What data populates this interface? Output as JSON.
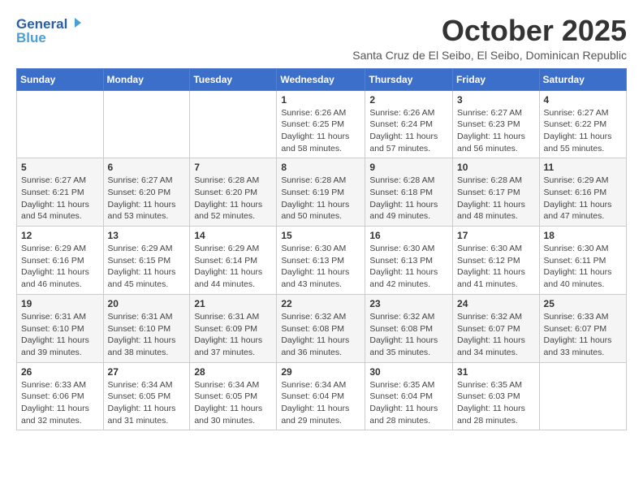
{
  "logo": {
    "line1": "General",
    "line2": "Blue"
  },
  "title": "October 2025",
  "subtitle": "Santa Cruz de El Seibo, El Seibo, Dominican Republic",
  "days_header": [
    "Sunday",
    "Monday",
    "Tuesday",
    "Wednesday",
    "Thursday",
    "Friday",
    "Saturday"
  ],
  "weeks": [
    [
      {
        "day": "",
        "info": ""
      },
      {
        "day": "",
        "info": ""
      },
      {
        "day": "",
        "info": ""
      },
      {
        "day": "1",
        "info": "Sunrise: 6:26 AM\nSunset: 6:25 PM\nDaylight: 11 hours\nand 58 minutes."
      },
      {
        "day": "2",
        "info": "Sunrise: 6:26 AM\nSunset: 6:24 PM\nDaylight: 11 hours\nand 57 minutes."
      },
      {
        "day": "3",
        "info": "Sunrise: 6:27 AM\nSunset: 6:23 PM\nDaylight: 11 hours\nand 56 minutes."
      },
      {
        "day": "4",
        "info": "Sunrise: 6:27 AM\nSunset: 6:22 PM\nDaylight: 11 hours\nand 55 minutes."
      }
    ],
    [
      {
        "day": "5",
        "info": "Sunrise: 6:27 AM\nSunset: 6:21 PM\nDaylight: 11 hours\nand 54 minutes."
      },
      {
        "day": "6",
        "info": "Sunrise: 6:27 AM\nSunset: 6:20 PM\nDaylight: 11 hours\nand 53 minutes."
      },
      {
        "day": "7",
        "info": "Sunrise: 6:28 AM\nSunset: 6:20 PM\nDaylight: 11 hours\nand 52 minutes."
      },
      {
        "day": "8",
        "info": "Sunrise: 6:28 AM\nSunset: 6:19 PM\nDaylight: 11 hours\nand 50 minutes."
      },
      {
        "day": "9",
        "info": "Sunrise: 6:28 AM\nSunset: 6:18 PM\nDaylight: 11 hours\nand 49 minutes."
      },
      {
        "day": "10",
        "info": "Sunrise: 6:28 AM\nSunset: 6:17 PM\nDaylight: 11 hours\nand 48 minutes."
      },
      {
        "day": "11",
        "info": "Sunrise: 6:29 AM\nSunset: 6:16 PM\nDaylight: 11 hours\nand 47 minutes."
      }
    ],
    [
      {
        "day": "12",
        "info": "Sunrise: 6:29 AM\nSunset: 6:16 PM\nDaylight: 11 hours\nand 46 minutes."
      },
      {
        "day": "13",
        "info": "Sunrise: 6:29 AM\nSunset: 6:15 PM\nDaylight: 11 hours\nand 45 minutes."
      },
      {
        "day": "14",
        "info": "Sunrise: 6:29 AM\nSunset: 6:14 PM\nDaylight: 11 hours\nand 44 minutes."
      },
      {
        "day": "15",
        "info": "Sunrise: 6:30 AM\nSunset: 6:13 PM\nDaylight: 11 hours\nand 43 minutes."
      },
      {
        "day": "16",
        "info": "Sunrise: 6:30 AM\nSunset: 6:13 PM\nDaylight: 11 hours\nand 42 minutes."
      },
      {
        "day": "17",
        "info": "Sunrise: 6:30 AM\nSunset: 6:12 PM\nDaylight: 11 hours\nand 41 minutes."
      },
      {
        "day": "18",
        "info": "Sunrise: 6:30 AM\nSunset: 6:11 PM\nDaylight: 11 hours\nand 40 minutes."
      }
    ],
    [
      {
        "day": "19",
        "info": "Sunrise: 6:31 AM\nSunset: 6:10 PM\nDaylight: 11 hours\nand 39 minutes."
      },
      {
        "day": "20",
        "info": "Sunrise: 6:31 AM\nSunset: 6:10 PM\nDaylight: 11 hours\nand 38 minutes."
      },
      {
        "day": "21",
        "info": "Sunrise: 6:31 AM\nSunset: 6:09 PM\nDaylight: 11 hours\nand 37 minutes."
      },
      {
        "day": "22",
        "info": "Sunrise: 6:32 AM\nSunset: 6:08 PM\nDaylight: 11 hours\nand 36 minutes."
      },
      {
        "day": "23",
        "info": "Sunrise: 6:32 AM\nSunset: 6:08 PM\nDaylight: 11 hours\nand 35 minutes."
      },
      {
        "day": "24",
        "info": "Sunrise: 6:32 AM\nSunset: 6:07 PM\nDaylight: 11 hours\nand 34 minutes."
      },
      {
        "day": "25",
        "info": "Sunrise: 6:33 AM\nSunset: 6:07 PM\nDaylight: 11 hours\nand 33 minutes."
      }
    ],
    [
      {
        "day": "26",
        "info": "Sunrise: 6:33 AM\nSunset: 6:06 PM\nDaylight: 11 hours\nand 32 minutes."
      },
      {
        "day": "27",
        "info": "Sunrise: 6:34 AM\nSunset: 6:05 PM\nDaylight: 11 hours\nand 31 minutes."
      },
      {
        "day": "28",
        "info": "Sunrise: 6:34 AM\nSunset: 6:05 PM\nDaylight: 11 hours\nand 30 minutes."
      },
      {
        "day": "29",
        "info": "Sunrise: 6:34 AM\nSunset: 6:04 PM\nDaylight: 11 hours\nand 29 minutes."
      },
      {
        "day": "30",
        "info": "Sunrise: 6:35 AM\nSunset: 6:04 PM\nDaylight: 11 hours\nand 28 minutes."
      },
      {
        "day": "31",
        "info": "Sunrise: 6:35 AM\nSunset: 6:03 PM\nDaylight: 11 hours\nand 28 minutes."
      },
      {
        "day": "",
        "info": ""
      }
    ]
  ]
}
